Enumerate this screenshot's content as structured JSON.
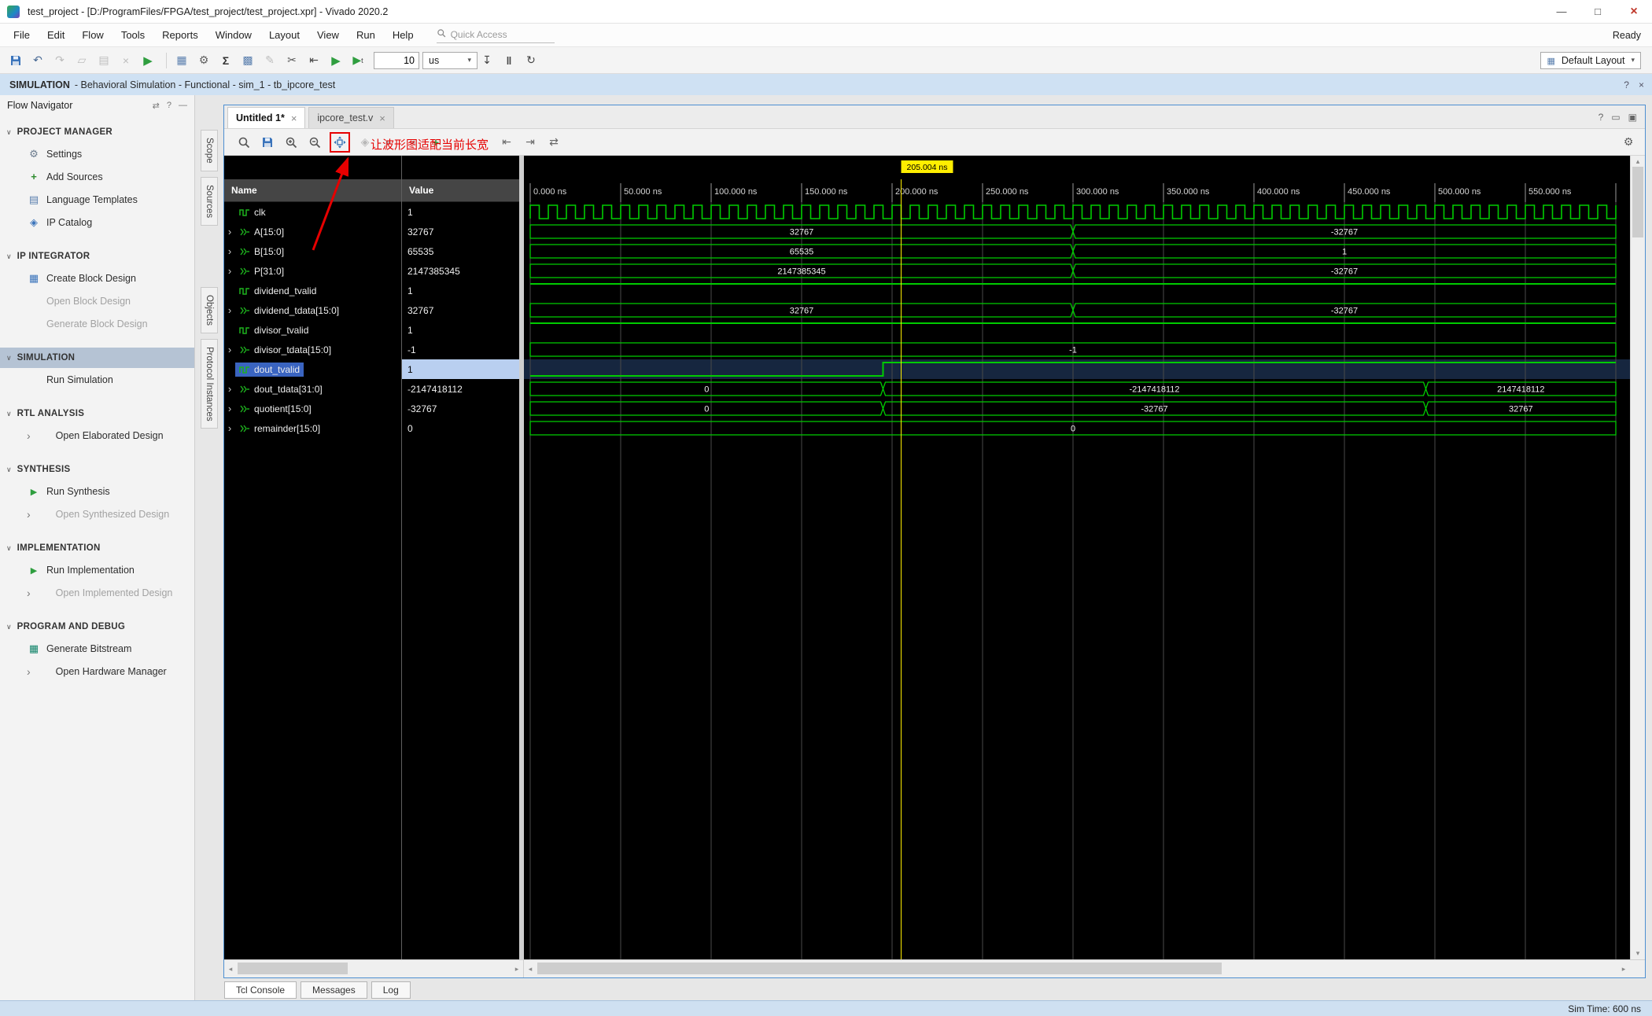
{
  "window": {
    "title": "test_project - [D:/ProgramFiles/FPGA/test_project/test_project.xpr] - Vivado 2020.2",
    "ready": "Ready"
  },
  "menubar": {
    "items": [
      "File",
      "Edit",
      "Flow",
      "Tools",
      "Reports",
      "Window",
      "Layout",
      "View",
      "Run",
      "Help"
    ],
    "quick_access_placeholder": "Quick Access"
  },
  "toolbar": {
    "left_icons": [
      "save",
      "undo",
      "redo",
      "copy",
      "paste",
      "delete",
      "run-flow",
      "separator",
      "layout-grid",
      "gear",
      "sum",
      "dashboard",
      "edit",
      "probes",
      "restart-sim",
      "run-all",
      "run-for-time"
    ],
    "run_time_value": "10",
    "run_time_unit": "us",
    "mid_icons": [
      "step",
      "pause",
      "relaunch"
    ],
    "layout_selector": "Default Layout"
  },
  "context_bar": {
    "title": "SIMULATION",
    "subtitle": "- Behavioral Simulation - Functional - sim_1 - tb_ipcore_test"
  },
  "flow_navigator": {
    "title": "Flow Navigator",
    "sections": [
      {
        "label": "PROJECT MANAGER",
        "selected": false,
        "items": [
          {
            "label": "Settings",
            "icon": "gear",
            "enabled": true,
            "chevron": false
          },
          {
            "label": "Add Sources",
            "icon": "add",
            "enabled": true,
            "chevron": false
          },
          {
            "label": "Language Templates",
            "icon": "doc",
            "enabled": true,
            "chevron": false
          },
          {
            "label": "IP Catalog",
            "icon": "ip",
            "enabled": true,
            "chevron": false
          }
        ]
      },
      {
        "label": "IP INTEGRATOR",
        "selected": false,
        "items": [
          {
            "label": "Create Block Design",
            "icon": "bd",
            "enabled": true,
            "chevron": false
          },
          {
            "label": "Open Block Design",
            "icon": "none",
            "enabled": false,
            "chevron": false
          },
          {
            "label": "Generate Block Design",
            "icon": "none",
            "enabled": false,
            "chevron": false
          }
        ]
      },
      {
        "label": "SIMULATION",
        "selected": true,
        "items": [
          {
            "label": "Run Simulation",
            "icon": "none",
            "enabled": true,
            "chevron": false
          }
        ]
      },
      {
        "label": "RTL ANALYSIS",
        "selected": false,
        "items": [
          {
            "label": "Open Elaborated Design",
            "icon": "none",
            "enabled": true,
            "chevron": true
          }
        ]
      },
      {
        "label": "SYNTHESIS",
        "selected": false,
        "items": [
          {
            "label": "Run Synthesis",
            "icon": "play",
            "enabled": true,
            "chevron": false
          },
          {
            "label": "Open Synthesized Design",
            "icon": "none",
            "enabled": false,
            "chevron": true
          }
        ]
      },
      {
        "label": "IMPLEMENTATION",
        "selected": false,
        "items": [
          {
            "label": "Run Implementation",
            "icon": "play",
            "enabled": true,
            "chevron": false
          },
          {
            "label": "Open Implemented Design",
            "icon": "none",
            "enabled": false,
            "chevron": true
          }
        ]
      },
      {
        "label": "PROGRAM AND DEBUG",
        "selected": false,
        "items": [
          {
            "label": "Generate Bitstream",
            "icon": "bit",
            "enabled": true,
            "chevron": false
          },
          {
            "label": "Open Hardware Manager",
            "icon": "none",
            "enabled": true,
            "chevron": true
          }
        ]
      }
    ]
  },
  "wave_window": {
    "tabs": [
      {
        "label": "Untitled 1*",
        "active": true
      },
      {
        "label": "ipcore_test.v",
        "active": false
      }
    ],
    "side_tabs": [
      "Scope",
      "Sources",
      "Objects",
      "Protocol Instances"
    ],
    "toolbar_icons_main": [
      "search",
      "save-wave",
      "zoom-in",
      "zoom-out",
      "zoom-fit"
    ],
    "toolbar_icons_overlapped": [
      "zoom-sel",
      "next-gray",
      "prev-gray",
      "add-gray"
    ],
    "toolbar_icons_markers": [
      "prev-marker",
      "next-marker",
      "swap-h"
    ],
    "columns": {
      "name": "Name",
      "value": "Value"
    },
    "annotation_text": "让波形图适配当前长宽",
    "colors": {
      "wave_green": "#00cc00",
      "cursor_yellow": "#ffee00",
      "annotation_red": "#e60000",
      "selection_blue": "#3a64c0"
    }
  },
  "chart_data": {
    "type": "waveform",
    "time_unit": "ns",
    "t_start": 0,
    "t_end": 600,
    "tick_interval": 50,
    "tick_labels": [
      "0.000 ns",
      "50.000 ns",
      "100.000 ns",
      "150.000 ns",
      "200.000 ns",
      "250.000 ns",
      "300.000 ns",
      "350.000 ns",
      "400.000 ns",
      "450.000 ns",
      "500.000 ns",
      "550.000 ns"
    ],
    "cursor_ns": 205.004,
    "cursor_label": "205.004 ns",
    "signals": [
      {
        "name": "clk",
        "value": "1",
        "kind": "clock",
        "period": 10,
        "selected": false
      },
      {
        "name": "A[15:0]",
        "value": "32767",
        "kind": "bus",
        "selected": false,
        "segments": [
          [
            0,
            300,
            "32767"
          ],
          [
            300,
            600,
            "-32767"
          ]
        ]
      },
      {
        "name": "B[15:0]",
        "value": "65535",
        "kind": "bus",
        "selected": false,
        "segments": [
          [
            0,
            300,
            "65535"
          ],
          [
            300,
            600,
            "1"
          ]
        ]
      },
      {
        "name": "P[31:0]",
        "value": "2147385345",
        "kind": "bus",
        "selected": false,
        "segments": [
          [
            0,
            300,
            "2147385345"
          ],
          [
            300,
            600,
            "-32767"
          ]
        ]
      },
      {
        "name": "dividend_tvalid",
        "value": "1",
        "kind": "scalar",
        "selected": false,
        "segments": [
          [
            0,
            600,
            1
          ]
        ]
      },
      {
        "name": "dividend_tdata[15:0]",
        "value": "32767",
        "kind": "bus",
        "selected": false,
        "segments": [
          [
            0,
            300,
            "32767"
          ],
          [
            300,
            600,
            "-32767"
          ]
        ]
      },
      {
        "name": "divisor_tvalid",
        "value": "1",
        "kind": "scalar",
        "selected": false,
        "segments": [
          [
            0,
            600,
            1
          ]
        ]
      },
      {
        "name": "divisor_tdata[15:0]",
        "value": "-1",
        "kind": "bus",
        "selected": false,
        "segments": [
          [
            0,
            600,
            "-1"
          ]
        ]
      },
      {
        "name": "dout_tvalid",
        "value": "1",
        "kind": "scalar",
        "selected": true,
        "segments": [
          [
            0,
            195,
            0
          ],
          [
            195,
            600,
            1
          ]
        ]
      },
      {
        "name": "dout_tdata[31:0]",
        "value": "-2147418112",
        "kind": "bus",
        "selected": false,
        "segments": [
          [
            0,
            195,
            "0"
          ],
          [
            195,
            495,
            "-2147418112"
          ],
          [
            495,
            600,
            "2147418112"
          ]
        ]
      },
      {
        "name": "quotient[15:0]",
        "value": "-32767",
        "kind": "bus",
        "selected": false,
        "segments": [
          [
            0,
            195,
            "0"
          ],
          [
            195,
            495,
            "-32767"
          ],
          [
            495,
            600,
            "32767"
          ]
        ]
      },
      {
        "name": "remainder[15:0]",
        "value": "0",
        "kind": "bus",
        "selected": false,
        "segments": [
          [
            0,
            600,
            "0"
          ]
        ]
      }
    ]
  },
  "bottom_panel": {
    "tabs": [
      "Tcl Console",
      "Messages",
      "Log"
    ]
  },
  "status_bar": {
    "sim_time": "Sim Time: 600 ns"
  }
}
